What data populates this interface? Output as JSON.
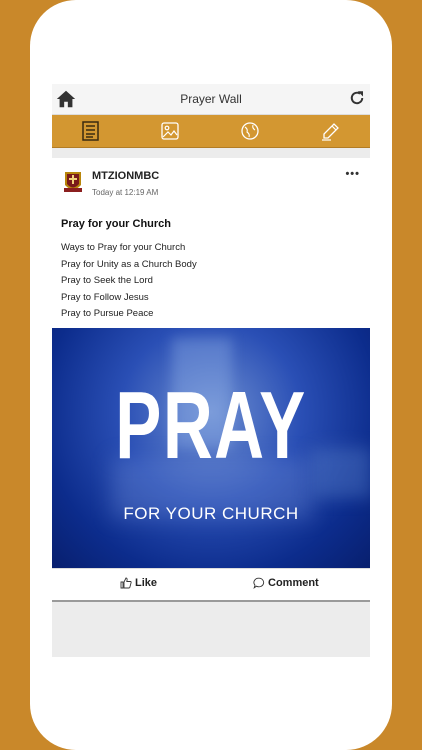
{
  "app": {
    "title": "Prayer Wall"
  },
  "icons": {
    "home": "home-icon",
    "refresh": "refresh-icon",
    "tabs": [
      "list-icon",
      "image-icon",
      "globe-icon",
      "edit-icon"
    ],
    "more": "more-icon",
    "like": "thumbs-up-icon",
    "comment": "comment-icon"
  },
  "colors": {
    "background": "#c9882a",
    "tabbar": "#d39731",
    "banner": "#1a3d9e"
  },
  "post": {
    "author": "MTZIONMBC",
    "time": "Today at 12:19 AM",
    "more_label": "•••",
    "title": "Pray for your Church",
    "lines": [
      "Ways to Pray for your Church",
      "Pray for Unity as a Church Body",
      "Pray to Seek the Lord",
      "Pray to Follow Jesus",
      "Pray to Pursue Peace"
    ],
    "image_text": "PRAY",
    "image_subtext": "FOR YOUR CHURCH",
    "like_label": "Like",
    "comment_label": "Comment"
  }
}
